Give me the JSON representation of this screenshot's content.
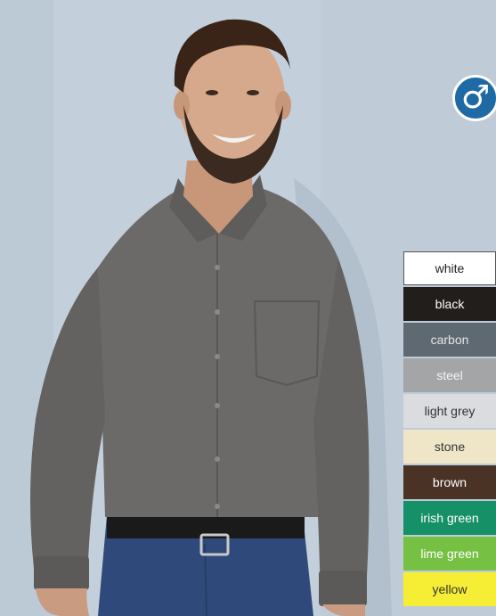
{
  "gender_icon": "male-symbol-icon",
  "gender_symbol": "♂",
  "colors": {
    "badge": "#1f6aa5",
    "wall": "#c3d0dc",
    "shirt": "#6c6a69",
    "trousers": "#2f4a7a"
  },
  "swatches": [
    {
      "label": "white",
      "bg": "#ffffff",
      "fg": "#222222"
    },
    {
      "label": "black",
      "bg": "#221e1c",
      "fg": "#ffffff"
    },
    {
      "label": "carbon",
      "bg": "#5e6972",
      "fg": "#e6e6e6"
    },
    {
      "label": "steel",
      "bg": "#a4a5a7",
      "fg": "#f4f4f4"
    },
    {
      "label": "light grey",
      "bg": "#dadcdf",
      "fg": "#333333"
    },
    {
      "label": "stone",
      "bg": "#efe6c7",
      "fg": "#333333"
    },
    {
      "label": "brown",
      "bg": "#4a3224",
      "fg": "#ffffff"
    },
    {
      "label": "irish green",
      "bg": "#169066",
      "fg": "#ffffff"
    },
    {
      "label": "lime green",
      "bg": "#76c043",
      "fg": "#ffffff"
    },
    {
      "label": "yellow",
      "bg": "#f6ee35",
      "fg": "#333333"
    }
  ]
}
